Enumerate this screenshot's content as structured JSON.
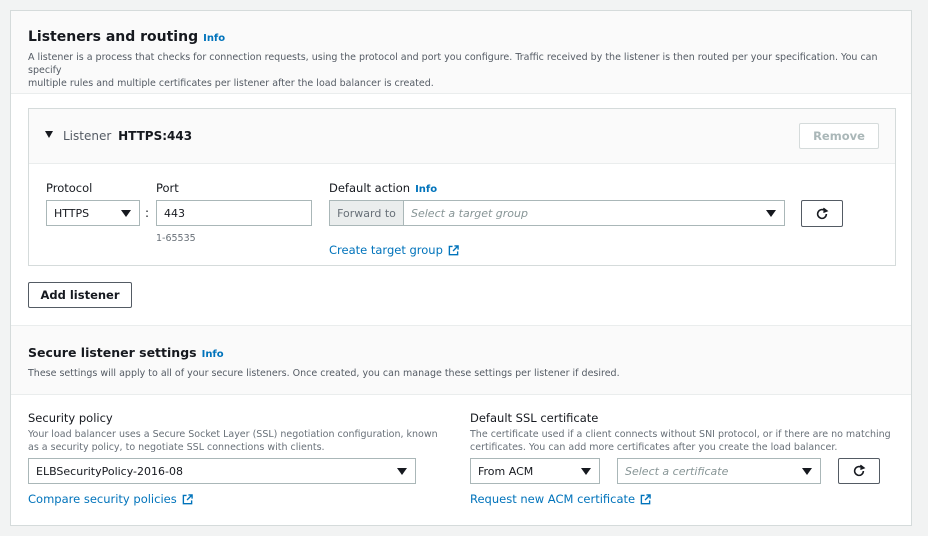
{
  "listeners": {
    "title": "Listeners and routing",
    "info": "Info",
    "description_line1": "A listener is a process that checks for connection requests, using the protocol and port you configure. Traffic received by the listener is then routed per your specification. You can specify",
    "description_line2": "multiple rules and multiple certificates per listener after the load balancer is created.",
    "listener": {
      "prefix": "Listener",
      "name": "HTTPS:443",
      "remove_label": "Remove",
      "protocol_label": "Protocol",
      "protocol_value": "HTTPS",
      "port_label": "Port",
      "port_value": "443",
      "port_hint": "1-65535",
      "colon": ":",
      "default_action_label": "Default action",
      "default_action_info": "Info",
      "forward_to": "Forward to",
      "target_group_placeholder": "Select a target group",
      "create_target_group": "Create target group"
    },
    "add_listener_label": "Add listener"
  },
  "secure": {
    "title": "Secure listener settings",
    "info": "Info",
    "description": "These settings will apply to all of your secure listeners. Once created, you can manage these settings per listener if desired.",
    "policy_label": "Security policy",
    "policy_desc_line1": "Your load balancer uses a Secure Socket Layer (SSL) negotiation configuration, known",
    "policy_desc_line2": "as a security policy, to negotiate SSL connections with clients.",
    "policy_value": "ELBSecurityPolicy-2016-08",
    "compare_policies": "Compare security policies",
    "cert_label": "Default SSL certificate",
    "cert_desc_line1": "The certificate used if a client connects without SNI protocol, or if there are no matching",
    "cert_desc_line2": "certificates. You can add more certificates after you create the load balancer.",
    "cert_source_value": "From ACM",
    "cert_placeholder": "Select a certificate",
    "request_cert": "Request new ACM certificate"
  },
  "colors": {
    "link": "#0073bb",
    "border": "#aab7b8",
    "text": "#16191f",
    "muted": "#545b64"
  }
}
